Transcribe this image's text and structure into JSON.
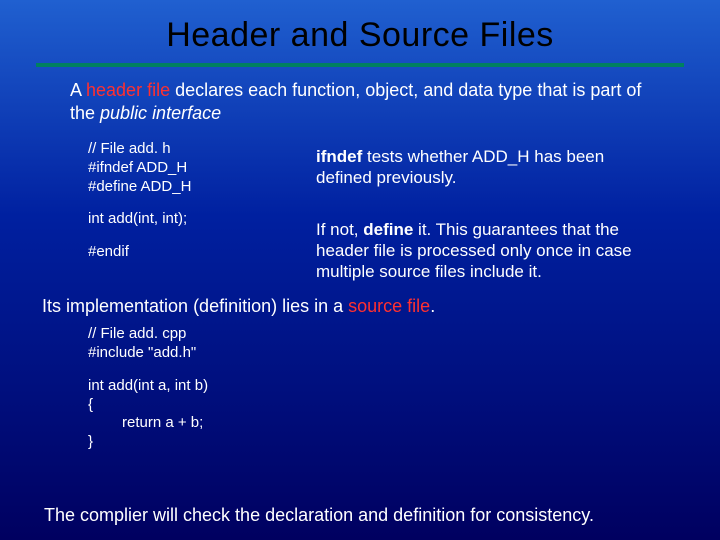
{
  "title": "Header and Source Files",
  "intro_prefix": "A ",
  "intro_red": "header file",
  "intro_mid": " declares each function, object, and data type that is part of the ",
  "intro_em": "public interface",
  "code1": {
    "comment": "// File add. h",
    "ifndef": "#ifndef ADD_H",
    "define": "#define ADD_H",
    "decl": "int add(int, int);",
    "endif": "#endif"
  },
  "desc1_bold": "ifndef",
  "desc1_rest": " tests whether ADD_H has been defined previously.",
  "desc2_prefix": "If not, ",
  "desc2_bold": "define",
  "desc2_rest": " it. This guarantees that the header file is processed only once in case multiple source files include it.",
  "middle_prefix": "Its implementation (definition) lies in a ",
  "middle_red": "source file",
  "middle_suffix": ".",
  "code2": {
    "comment": "// File add. cpp",
    "include": "#include \"add.h\"",
    "sig": "int add(int a, int b)",
    "open": "{",
    "ret": "return a + b;",
    "close": "}"
  },
  "footer": "The complier will check the declaration and definition for consistency."
}
